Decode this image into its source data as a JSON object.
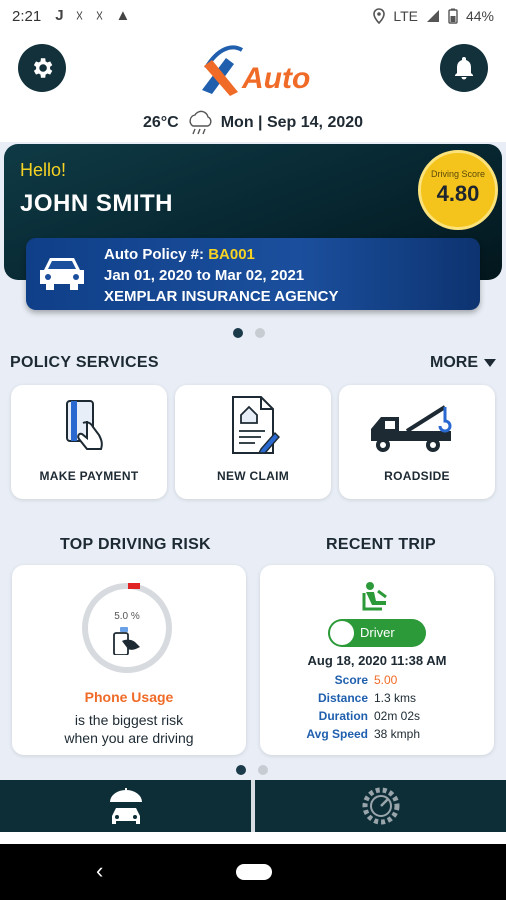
{
  "status": {
    "time": "2:21",
    "icons": [
      "J",
      "☓",
      "☓",
      "▲"
    ],
    "network": "LTE",
    "battery": "44%"
  },
  "header": {
    "logo_text": "Auto",
    "temperature": "26°C",
    "date": "Mon | Sep 14, 2020"
  },
  "hero": {
    "greeting": "Hello!",
    "name": "JOHN SMITH",
    "score_label": "Driving Score",
    "score_value": "4.80"
  },
  "policy": {
    "number_label": "Auto Policy #:",
    "number_value": "BA001",
    "dates": "Jan 01, 2020 to Mar 02, 2021",
    "agency": "XEMPLAR INSURANCE AGENCY"
  },
  "policy_services": {
    "title": "POLICY SERVICES",
    "more_label": "MORE",
    "items": [
      {
        "label": "MAKE PAYMENT",
        "icon": "card-payment-icon"
      },
      {
        "label": "NEW CLAIM",
        "icon": "claim-document-icon"
      },
      {
        "label": "ROADSIDE",
        "icon": "tow-truck-icon"
      }
    ]
  },
  "risk": {
    "title": "TOP DRIVING RISK",
    "percent": "5.0 %",
    "percent_value": 5.0,
    "name": "Phone Usage",
    "text_line1": "is the biggest risk",
    "text_line2": "when you are driving"
  },
  "trip": {
    "title": "RECENT TRIP",
    "toggle_label": "Driver",
    "date": "Aug 18, 2020 11:38 AM",
    "rows": [
      {
        "key": "Score",
        "value": "5.00"
      },
      {
        "key": "Distance",
        "value": "1.3 kms"
      },
      {
        "key": "Duration",
        "value": "02m 02s"
      },
      {
        "key": "Avg Speed",
        "value": "38 kmph"
      }
    ]
  },
  "colors": {
    "dark_teal": "#0d2e37",
    "accent_yellow": "#f6d323",
    "orange": "#f06b28",
    "blue": "#1f5fae",
    "green": "#2d9a3a"
  }
}
